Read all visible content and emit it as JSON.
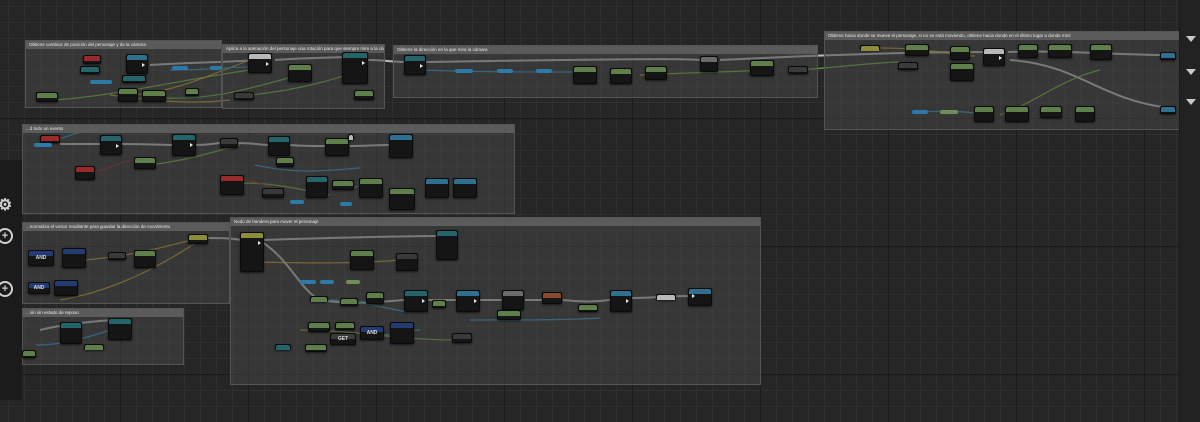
{
  "app": {
    "editor": "Blueprint Event Graph"
  },
  "left_panel": {
    "icons": [
      "gear-icon",
      "add-circle-icon",
      "add-circle-icon"
    ],
    "add_glyph": "+",
    "gear_glyph": "⚙"
  },
  "right_panel": {
    "icons": [
      "collapse-arrow-icon",
      "collapse-arrow-icon",
      "collapse-arrow-icon"
    ]
  },
  "comments": [
    {
      "id": "c1",
      "title": "Obtiene cambios de posición del personaje y de la cámara"
    },
    {
      "id": "c2",
      "title": "Aplica a la animación del personaje una rotación para que siempre mire a la cámara"
    },
    {
      "id": "c3",
      "title": "Obtiene la dirección en la que mira la cámara"
    },
    {
      "id": "c4",
      "title": "Obtiene hacia donde se mueve el personaje, si no se está moviendo, obtiene hacia donde en el último lugar a donde miró"
    },
    {
      "id": "c5",
      "title": "...d todo un evento"
    },
    {
      "id": "c6",
      "title": "...normaliza el vector resultante para guardar la dirección de movimiento"
    },
    {
      "id": "c7",
      "title": "Nodo de bandera para mover el personaje"
    },
    {
      "id": "c8",
      "title": "...ión sin estado de reposo"
    }
  ],
  "node_labels": {
    "and": "AND",
    "get": "GET"
  },
  "colors": {
    "exec_wire": "#c8c8c8",
    "float_wire": "#6fbf3b",
    "vector_wire": "#e6b422",
    "object_wire": "#2c9fd8",
    "bool_wire": "#8b1f1f",
    "comment_bg": "#464646",
    "graph_bg": "#262626"
  }
}
